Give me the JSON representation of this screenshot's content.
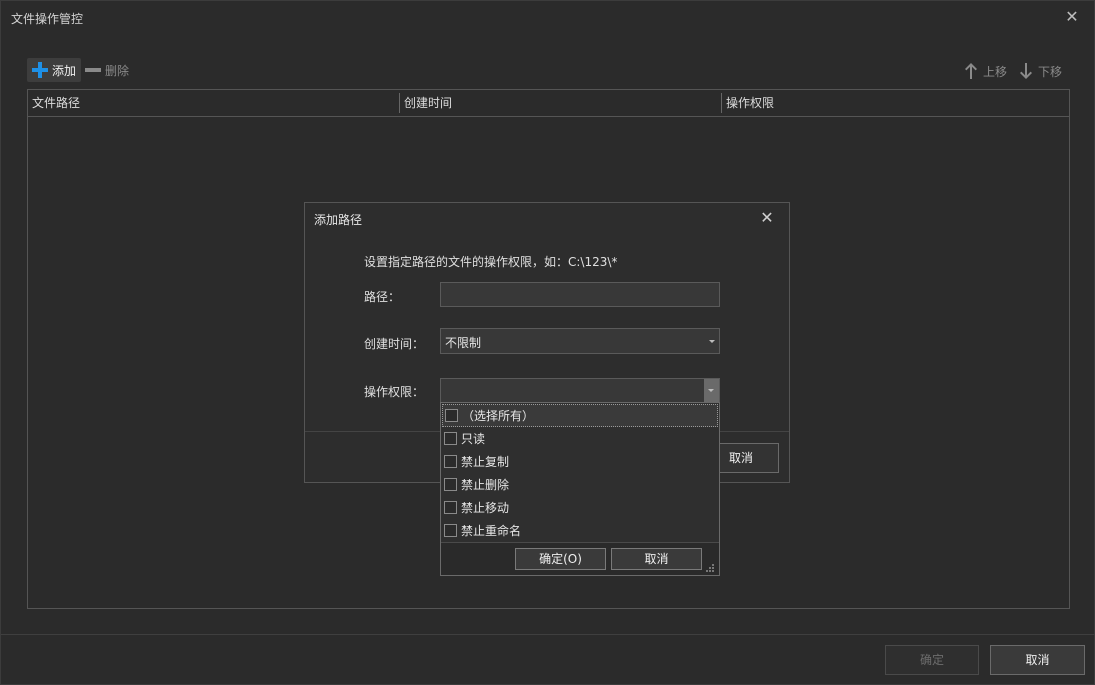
{
  "window": {
    "title": "文件操作管控",
    "close_glyph": "✕"
  },
  "toolbar": {
    "add_label": "添加",
    "delete_label": "删除",
    "up_label": "上移",
    "down_label": "下移"
  },
  "table": {
    "columns": [
      "文件路径",
      "创建时间",
      "操作权限"
    ],
    "rows": []
  },
  "footer": {
    "ok_label": "确定",
    "cancel_label": "取消"
  },
  "dialog": {
    "title": "添加路径",
    "close_glyph": "✕",
    "hint": "设置指定路径的文件的操作权限，如：C:\\123\\*",
    "path_label": "路径：",
    "path_value": "",
    "time_label": "创建时间：",
    "time_value": "不限制",
    "perm_label": "操作权限：",
    "perm_value": "",
    "cancel_label": "取消"
  },
  "perm_popup": {
    "options": [
      {
        "label": "（选择所有）",
        "checked": false
      },
      {
        "label": "只读",
        "checked": false
      },
      {
        "label": "禁止复制",
        "checked": false
      },
      {
        "label": "禁止删除",
        "checked": false
      },
      {
        "label": "禁止移动",
        "checked": false
      },
      {
        "label": "禁止重命名",
        "checked": false
      }
    ],
    "ok_label": "确定(O)",
    "cancel_label": "取消"
  },
  "colors": {
    "accent": "#1e90e6",
    "background": "#2b2b2b",
    "border": "#555555"
  },
  "icons": {
    "add": "plus-icon",
    "delete": "minus-icon",
    "up": "arrow-up-icon",
    "down": "arrow-down-icon",
    "close": "close-icon",
    "resize": "resize-grip-icon"
  }
}
